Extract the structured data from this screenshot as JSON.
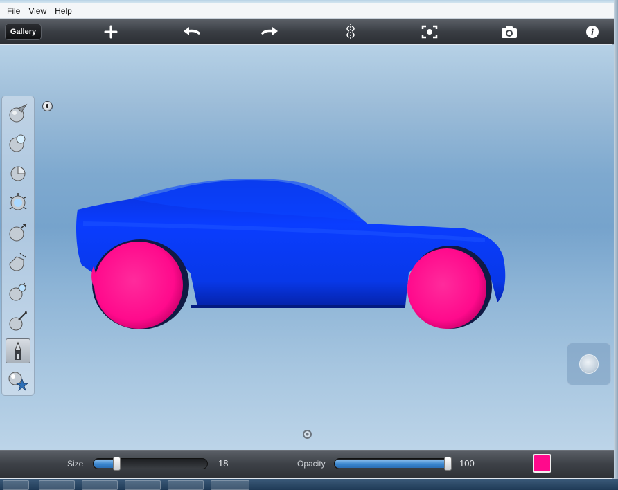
{
  "menu": [
    {
      "label": "File"
    },
    {
      "label": "View"
    },
    {
      "label": "Help"
    }
  ],
  "toolbar": {
    "gallery_label": "Gallery",
    "icons": [
      "add-icon",
      "undo-icon",
      "redo-icon",
      "symmetry-icon",
      "reset-view-icon",
      "camera-icon",
      "info-icon"
    ]
  },
  "tools": [
    {
      "name": "sculpt-draw-tool-icon"
    },
    {
      "name": "sculpt-clay-tool-icon"
    },
    {
      "name": "sculpt-grab-tool-icon"
    },
    {
      "name": "sculpt-smooth-tool-icon"
    },
    {
      "name": "sculpt-pinch-tool-icon"
    },
    {
      "name": "sculpt-flatten-tool-icon"
    },
    {
      "name": "sculpt-inflate-tool-icon"
    },
    {
      "name": "sculpt-crease-tool-icon"
    },
    {
      "name": "paint-tool-icon",
      "selected": true
    },
    {
      "name": "material-tool-icon"
    }
  ],
  "bottom": {
    "size_label": "Size",
    "size_value": "18",
    "size_fraction": 0.18,
    "opacity_label": "Opacity",
    "opacity_value": "100",
    "opacity_fraction": 1.0,
    "paint_color": "#ff0a8c"
  },
  "colors": {
    "car_body": "#0a3dff",
    "wheel": "#ff0a8c",
    "accent": "#3a86cf"
  }
}
